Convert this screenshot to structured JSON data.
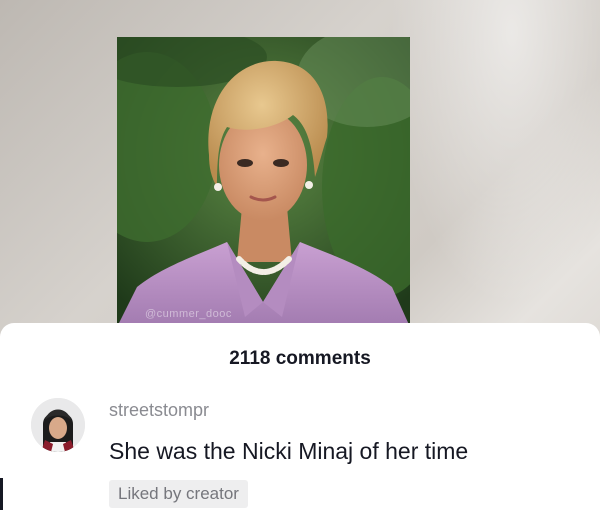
{
  "video": {
    "watermark": "@cummer_dooc"
  },
  "comments_panel": {
    "count_label": "2118 comments",
    "comments": [
      {
        "username": "streetstompr",
        "text": "She was the Nicki Minaj of her time",
        "badge": "Liked by creator"
      }
    ]
  },
  "colors": {
    "panel_bg": "#ffffff",
    "primary_text": "#161823",
    "secondary_text": "#8a8b91",
    "badge_bg": "#eeeeef"
  },
  "icons": {
    "avatar": "user-avatar"
  }
}
